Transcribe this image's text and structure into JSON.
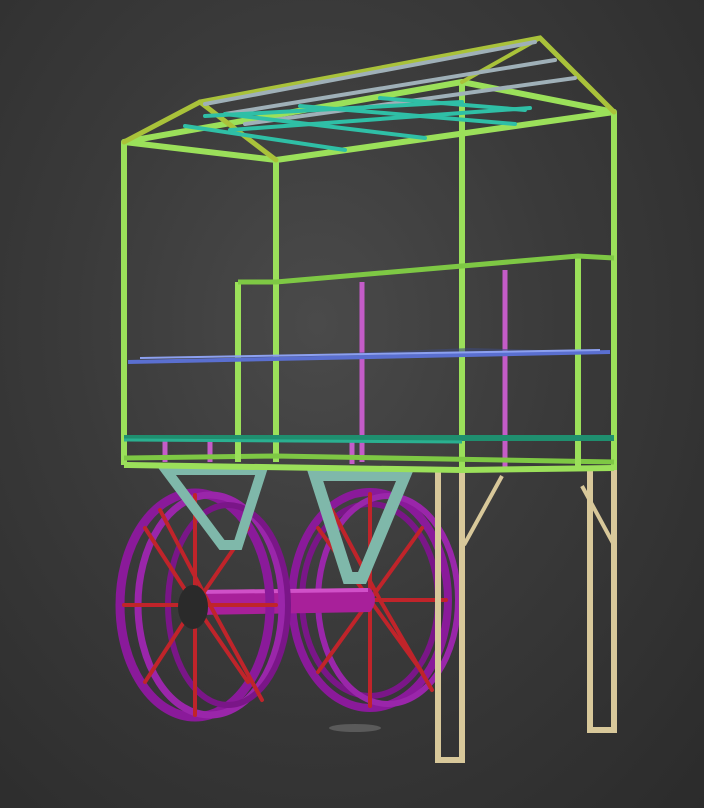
{
  "scene": {
    "subject": "cart-frame-wireframe-render",
    "colors": {
      "background": "#3c3c3c",
      "frame_green": "#9be05a",
      "frame_olive": "#a9c23a",
      "roof_teal": "#2fbfa6",
      "roof_gray": "#9fb0b8",
      "shelf_blue": "#5a6fd0",
      "rail_teal": "#1f8f6f",
      "post_magenta": "#c45cc8",
      "leg_tan": "#d8c89a",
      "bracket_mint": "#a8d8cc",
      "wheel_purple": "#8a1a9a",
      "spoke_red": "#c0242a",
      "axle_magenta": "#b0209c",
      "hub_dark": "#2a2a2a"
    }
  }
}
